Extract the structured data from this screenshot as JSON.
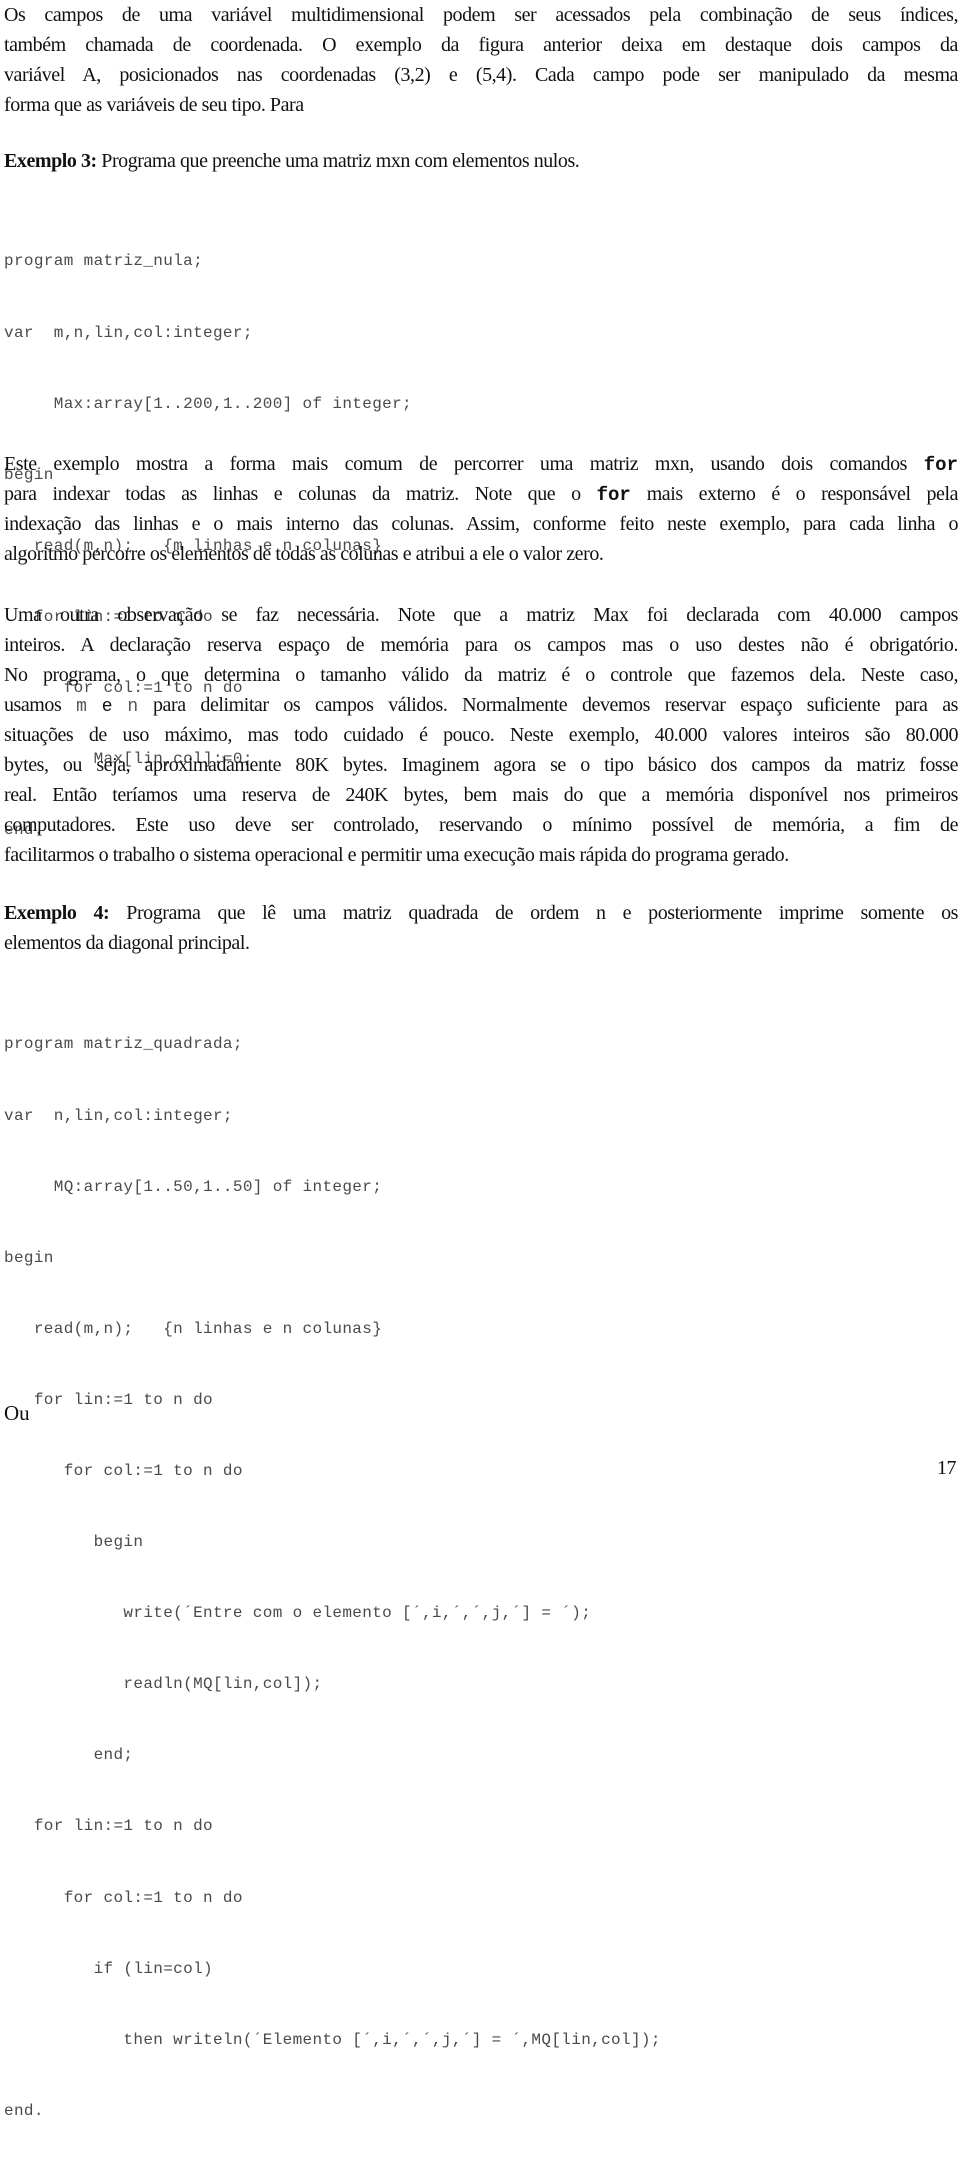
{
  "intro_paragraph": {
    "lines": [
      "Os campos de uma variável multidimensional podem ser acessados pela combinação de seus índices,",
      "também chamada de coordenada. O exemplo da figura anterior deixa em destaque dois campos da",
      "variável A, posicionados nas coordenadas (3,2) e (5,4). Cada campo pode ser manipulado da mesma",
      "forma que as variáveis de seu tipo. Para"
    ]
  },
  "example3": {
    "label": "Exemplo 3:",
    "description": " Programa que preenche uma matriz mxn com elementos nulos.",
    "code_lines": [
      "program matriz_nula;",
      "var  m,n,lin,col:integer;",
      "     Max:array[1..200,1..200] of integer;",
      "begin",
      "   read(m,n);   {m linhas e n colunas}",
      "   for lin:=1 to m do",
      "      for col:=1 to n do",
      "         Max[lin,col]:=0;",
      "end."
    ]
  },
  "explanation_paragraph": {
    "line1_before": "Este exemplo mostra a forma mais comum de percorrer uma matriz mxn, usando dois comandos ",
    "line1_code": "for",
    "line2_before": "para indexar todas as linhas e colunas da matriz. Note que o ",
    "line2_code": "for",
    "line2_after": " mais externo é o responsável pela",
    "line3": "indexação das linhas e o mais interno das colunas. Assim, conforme feito neste exemplo, para cada linha o",
    "line4": "algoritmo percorre os elementos de todas as colunas e atribui a ele o valor zero."
  },
  "observation_paragraph": {
    "line1": "Uma outra observação se faz necessária. Note que a matriz Max foi declarada com 40.000 campos",
    "line2": "inteiros. A declaração reserva espaço de memória para os campos mas o uso destes não é obrigatório.",
    "line3": "No programa, o que determina o tamanho válido da matriz é o controle que fazemos dela. Neste caso,",
    "line4_before": "usamos ",
    "line4_m": "m",
    "line4_e": " e ",
    "line4_n": "n",
    "line4_after": " para delimitar os campos válidos. Normalmente devemos reservar espaço suficiente para as",
    "line5": "situações de uso máximo, mas todo cuidado é pouco. Neste exemplo, 40.000 valores inteiros são 80.000",
    "line6": "bytes, ou seja, aproximadamente 80K bytes. Imaginem agora se o tipo básico dos campos da matriz fosse",
    "line7": "real. Então teríamos uma reserva de 240K bytes, bem mais do que a memória disponível nos primeiros",
    "line8": "computadores. Este uso deve ser controlado, reservando o mínimo possível de memória, a fim de",
    "line9": "facilitarmos o trabalho o sistema operacional e permitir uma execução mais rápida do programa gerado."
  },
  "example4": {
    "label": "Exemplo 4:",
    "line1": "  Programa que lê uma matriz quadrada de ordem n e posteriormente imprime somente os",
    "line2": "elementos da diagonal principal.",
    "code_lines": [
      "program matriz_quadrada;",
      "var  n,lin,col:integer;",
      "     MQ:array[1..50,1..50] of integer;",
      "begin",
      "   read(m,n);   {n linhas e n colunas}",
      "   for lin:=1 to n do",
      "      for col:=1 to n do",
      "         begin",
      "            write(´Entre com o elemento [´,i,´,´,j,´] = ´);",
      "            readln(MQ[lin,col]);",
      "         end;",
      "   for lin:=1 to n do",
      "      for col:=1 to n do",
      "         if (lin=col)",
      "            then writeln(´Elemento [´,i,´,´,j,´] = ´,MQ[lin,col]);",
      "end."
    ]
  },
  "trailing_text": "Ou",
  "page_number": "17"
}
